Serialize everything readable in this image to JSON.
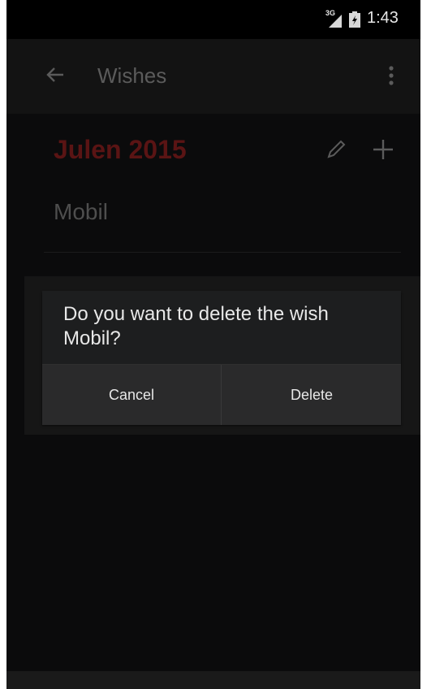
{
  "status_bar": {
    "network": "3G",
    "time": "1:43"
  },
  "app_bar": {
    "title": "Wishes",
    "back_icon": "arrow-left-icon",
    "overflow_icon": "more-vert-icon"
  },
  "list": {
    "title": "Julen 2015",
    "title_color": "#5a1414",
    "edit_icon": "pencil-icon",
    "add_icon": "plus-icon",
    "items": [
      {
        "label": "Mobil"
      }
    ]
  },
  "dialog": {
    "message": "Do you want to delete the wish Mobil?",
    "cancel_label": "Cancel",
    "delete_label": "Delete"
  }
}
